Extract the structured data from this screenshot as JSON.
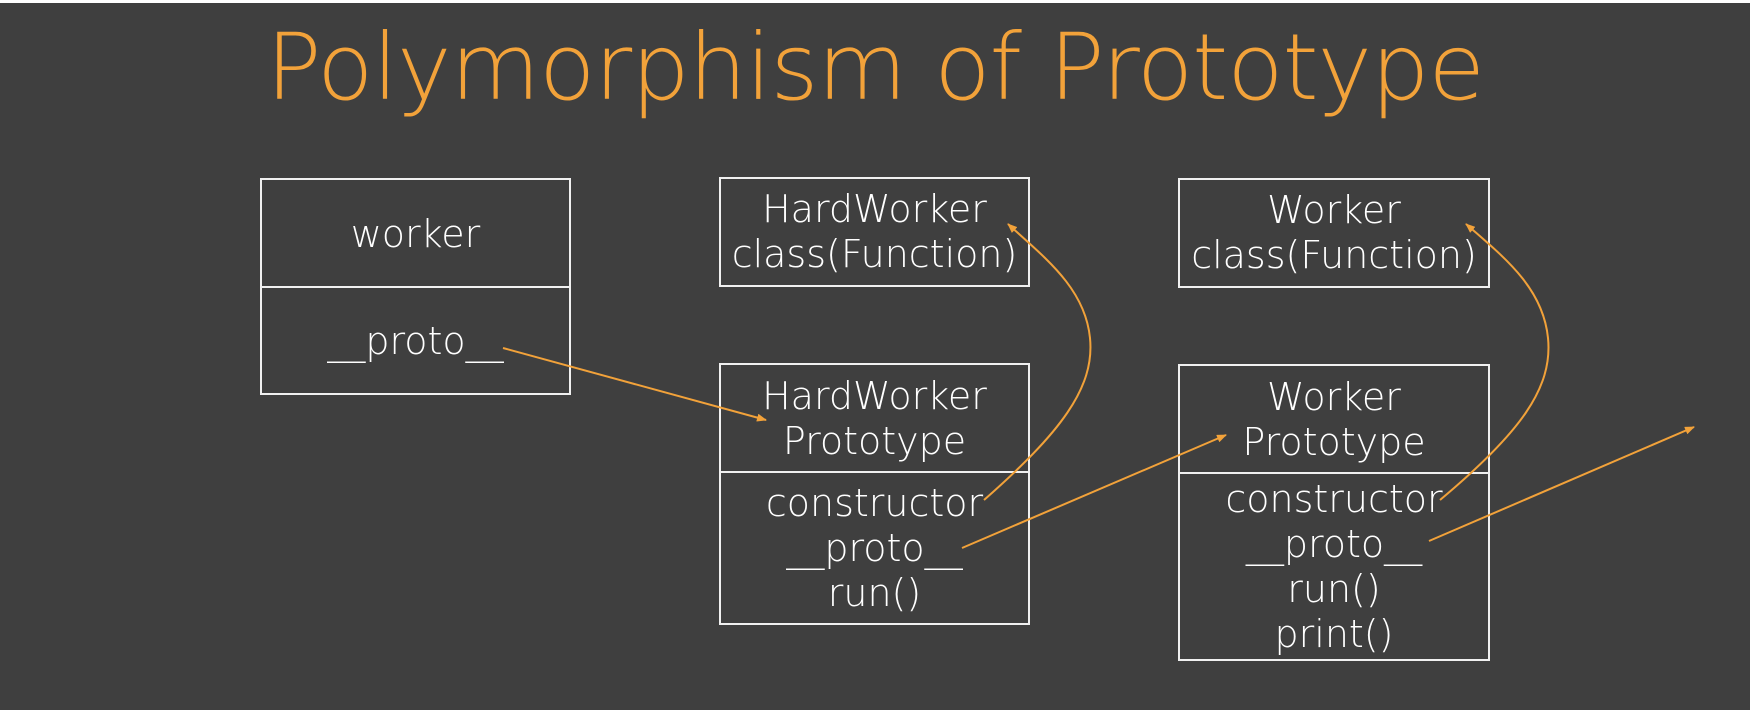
{
  "title": "Polymorphism of Prototype",
  "worker": {
    "name": "worker",
    "proto": "__proto__"
  },
  "hardworker_class": {
    "line1": "HardWorker",
    "line2": "class(Function)"
  },
  "hardworker_prototype": {
    "line1": "HardWorker",
    "line2": "Prototype",
    "members": [
      "constructor",
      "__proto__",
      "run()"
    ]
  },
  "worker_class": {
    "line1": "Worker",
    "line2": "class(Function)"
  },
  "worker_prototype": {
    "line1": "Worker",
    "line2": "Prototype",
    "members": [
      "constructor",
      "__proto__",
      "run()",
      "print()"
    ]
  },
  "colors": {
    "background": "#3f3f3f",
    "accent": "#f2a23a",
    "text": "#ffffff",
    "border": "#f0f0f0"
  }
}
